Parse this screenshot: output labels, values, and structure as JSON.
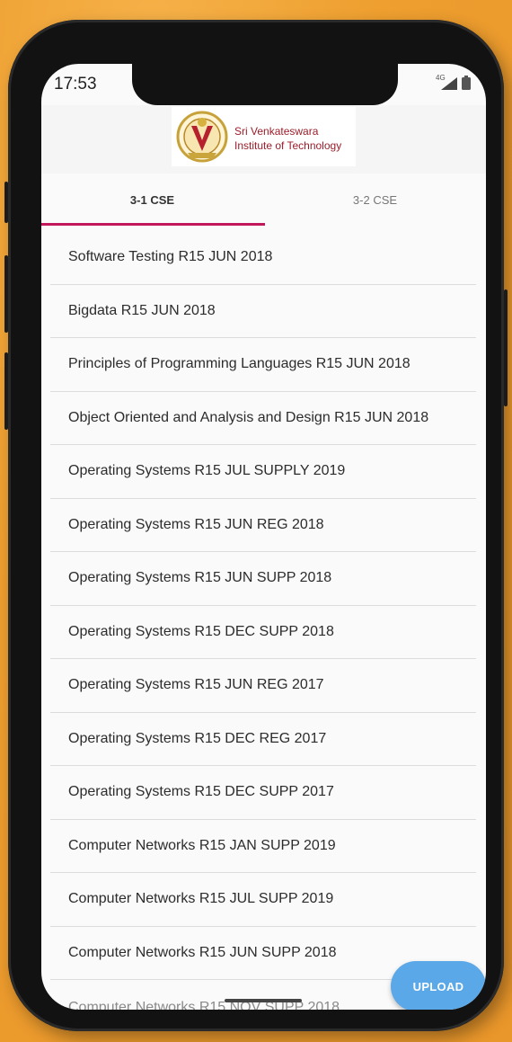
{
  "status_bar": {
    "time": "17:53",
    "network": "4G"
  },
  "header": {
    "logo_line1": "Sri Venkateswara",
    "logo_line2": "Institute of Technology"
  },
  "tabs": [
    {
      "label": "3-1 CSE",
      "active": true
    },
    {
      "label": "3-2 CSE",
      "active": false
    }
  ],
  "papers": [
    "Software Testing R15 JUN 2018",
    "Bigdata R15 JUN 2018",
    "Principles of Programming Languages R15 JUN 2018",
    "Object Oriented and Analysis and Design R15 JUN 2018",
    "Operating Systems R15 JUL SUPPLY 2019",
    "Operating Systems R15 JUN REG 2018",
    "Operating Systems R15 JUN SUPP 2018",
    "Operating Systems R15 DEC SUPP 2018",
    "Operating Systems R15 JUN REG 2017",
    "Operating Systems R15 DEC REG 2017",
    "Operating Systems R15 DEC SUPP 2017",
    "Computer Networks R15 JAN SUPP 2019",
    "Computer Networks R15 JUL SUPP 2019",
    "Computer Networks R15 JUN SUPP 2018",
    "Computer Networks R15 NOV SUPP 2018"
  ],
  "fab": {
    "label": "UPLOAD"
  },
  "colors": {
    "accent": "#c2185b",
    "fab": "#5ba8e8",
    "logo_text": "#9b1d2a"
  }
}
